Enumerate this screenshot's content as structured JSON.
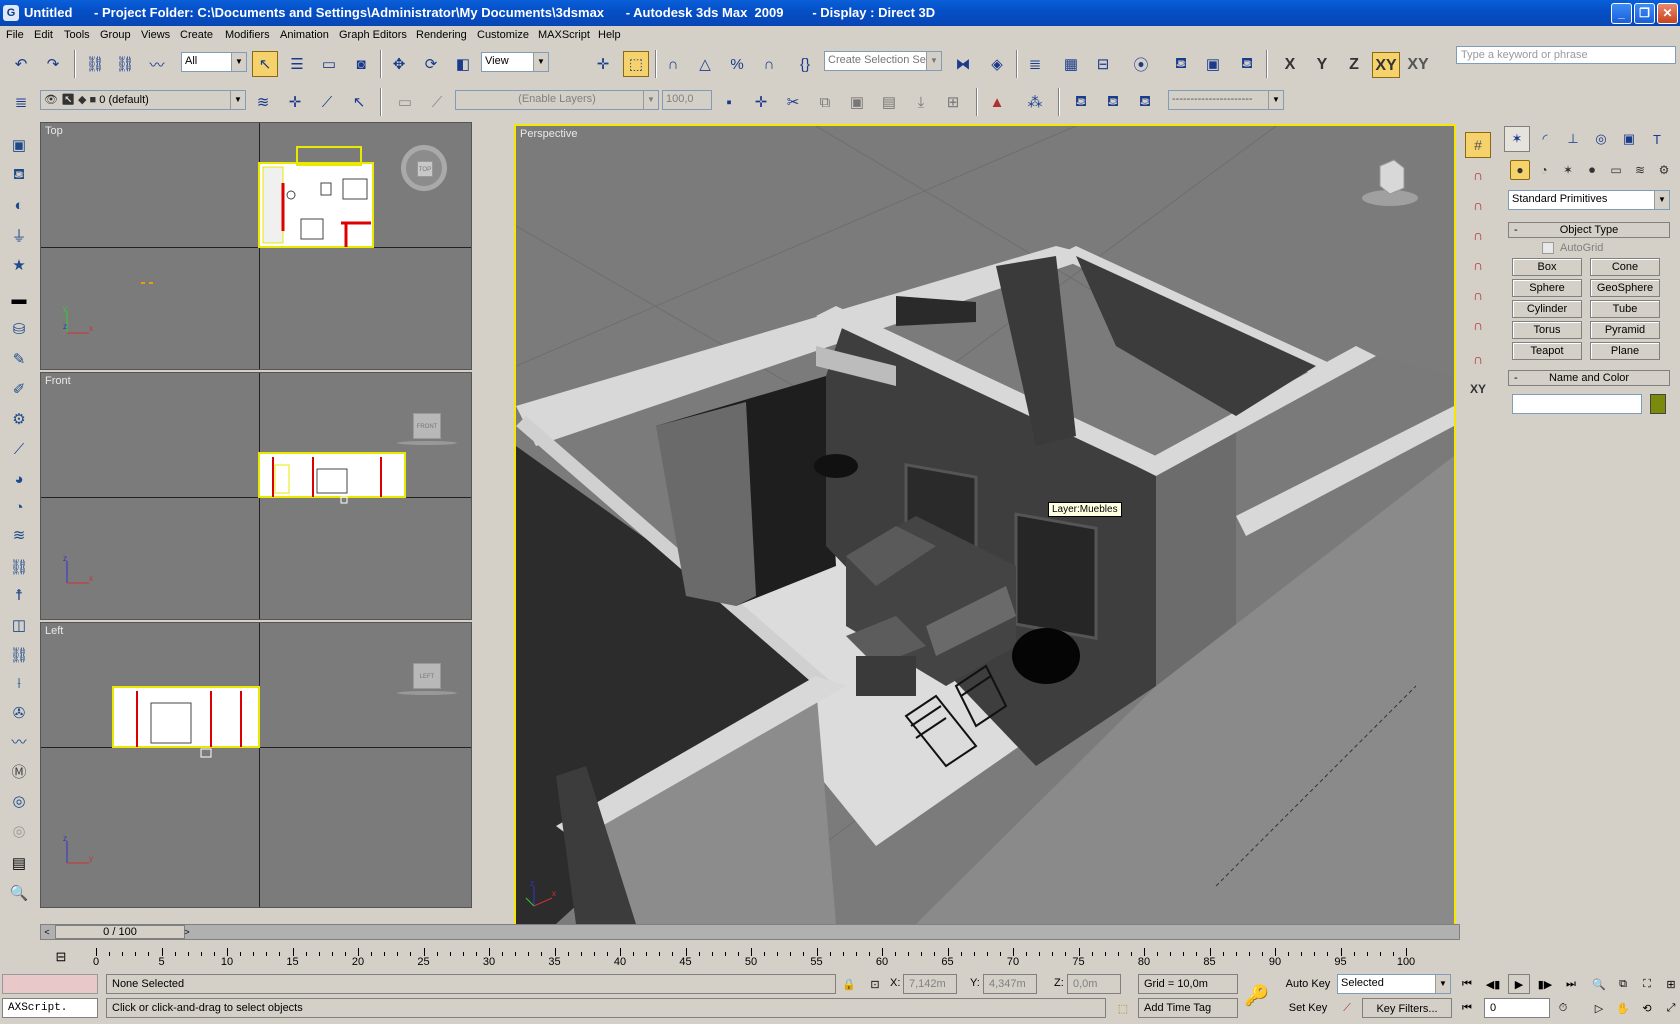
{
  "window": {
    "title": "Untitled      - Project Folder: C:\\Documents and Settings\\Administrator\\My Documents\\3dsmax      - Autodesk 3ds Max  2009        - Display : Direct 3D",
    "buttons": [
      "minimize",
      "maximize",
      "close"
    ]
  },
  "menu": [
    "File",
    "Edit",
    "Tools",
    "Group",
    "Views",
    "Create",
    "Modifiers",
    "Animation",
    "Graph Editors",
    "Rendering",
    "Customize",
    "MAXScript",
    "Help"
  ],
  "toolbar": {
    "selection_filter": "All",
    "reference_coord": "View",
    "named_selection_placeholder": "Create Selection Se",
    "search_placeholder": "Type a keyword or phrase",
    "axis_constraints": [
      "X",
      "Y",
      "Z",
      "XY",
      "XY"
    ],
    "active_axis": "XY"
  },
  "layer_toolbar": {
    "layer": "0 (default)",
    "enable_layers": "(Enable Layers)",
    "percent": "100,0"
  },
  "viewports": {
    "top": "Top",
    "front": "Front",
    "left": "Left",
    "perspective": "Perspective",
    "tooltip": "Layer:Muebles"
  },
  "navcube_labels": {
    "top": "TOP",
    "front": "FRONT",
    "left": "LEFT"
  },
  "command_panel": {
    "category": "Standard Primitives",
    "object_type_title": "Object Type",
    "autogrid": "AutoGrid",
    "primitives": [
      "Box",
      "Cone",
      "Sphere",
      "GeoSphere",
      "Cylinder",
      "Tube",
      "Torus",
      "Pyramid",
      "Teapot",
      "Plane"
    ],
    "name_color_title": "Name and Color",
    "swatch_color": "#7a8a0a"
  },
  "timeline": {
    "slider": "0 / 100",
    "ticks": [
      0,
      5,
      10,
      15,
      20,
      25,
      30,
      35,
      40,
      45,
      50,
      55,
      60,
      65,
      70,
      75,
      80,
      85,
      90,
      95,
      100
    ]
  },
  "status": {
    "script_listener": "AXScript.",
    "selection": "None Selected",
    "prompt": "Click or click-and-drag to select objects",
    "x": "7,142m",
    "y": "4,347m",
    "z": "0,0m",
    "grid": "Grid = 10,0m",
    "add_time_tag": "Add Time Tag",
    "auto_key": "Auto Key",
    "set_key": "Set Key",
    "key_mode": "Selected",
    "key_filters": "Key Filters...",
    "frame": "0"
  },
  "colors": {
    "active_viewport_border": "#f4e800",
    "viewport_bg": "#7b7b7b",
    "ui_bg": "#d4d0c8",
    "title_blue": "#0550c8"
  }
}
